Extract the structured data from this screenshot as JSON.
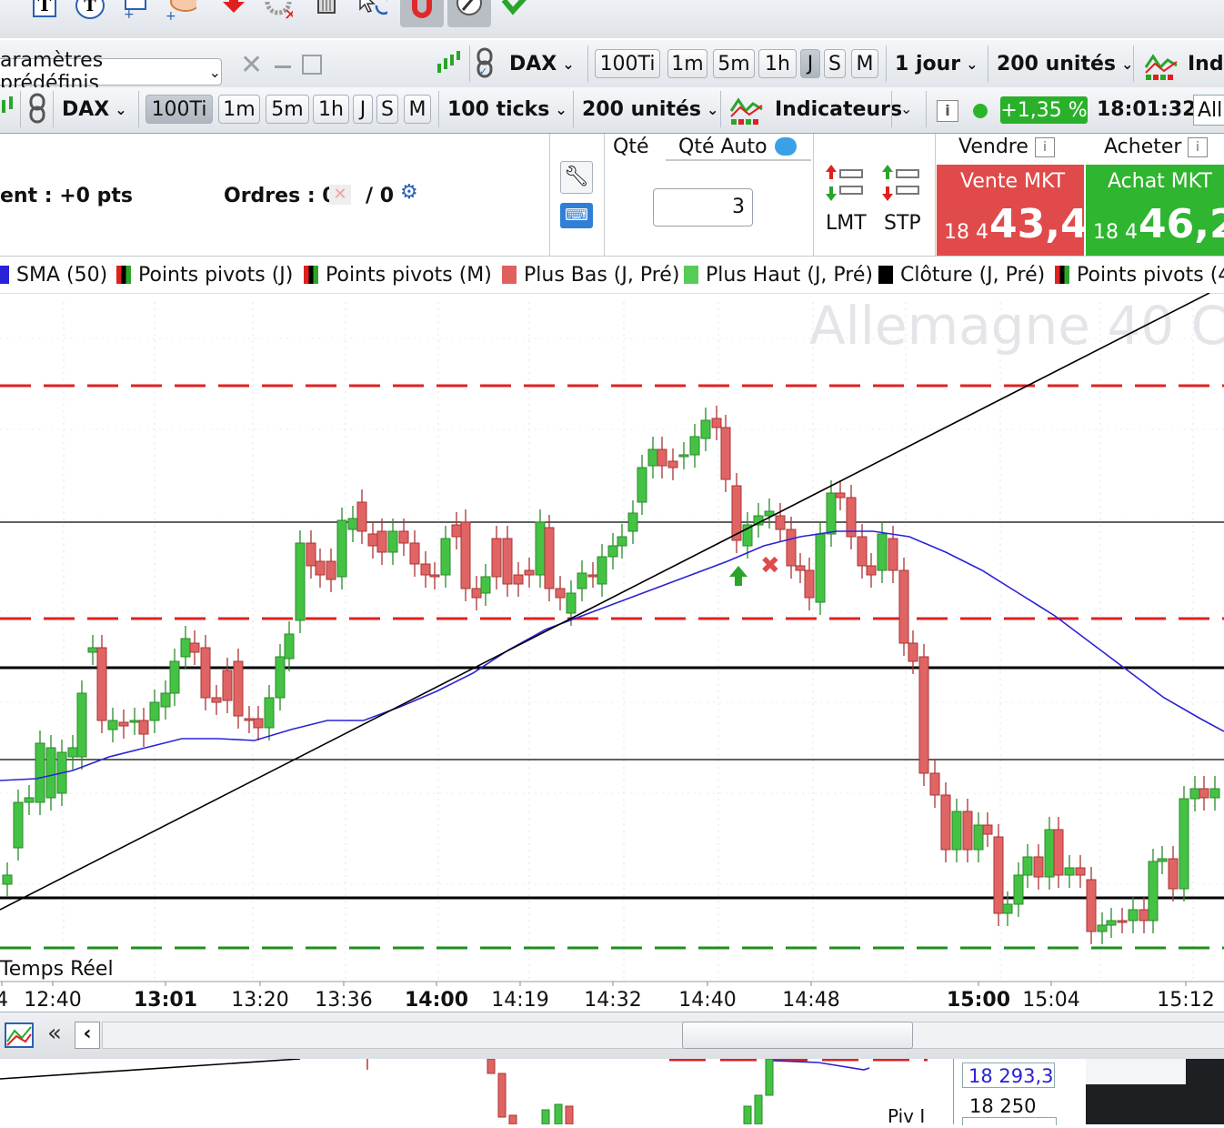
{
  "toolbar": {
    "icons": [
      "text-tool-icon",
      "text-bubble-icon",
      "rectangle-tool-icon",
      "ellipse-tool-icon",
      "arrow-down-icon",
      "delete-drawings-icon",
      "trash-icon",
      "cursor-undo-icon",
      "magnet-icon",
      "pencil-icon",
      "checkmark-icon"
    ]
  },
  "window_bar": {
    "presets": "aramètres prédéfinis",
    "instrument": "DAX",
    "timeframes": [
      "100Ti",
      "1m",
      "5m",
      "1h",
      "J",
      "S",
      "M"
    ],
    "period": "1 jour",
    "units": "200 unités",
    "indicators": "Indi"
  },
  "chart_bar": {
    "instrument": "DAX",
    "timeframes": [
      "100Ti",
      "1m",
      "5m",
      "1h",
      "J",
      "S",
      "M"
    ],
    "active_timeframe": "100Ti",
    "period": "100 ticks",
    "units": "200 unités",
    "indicators": "Indicateurs",
    "change": "+1,35 %",
    "time": "18:01:32",
    "alert": "All"
  },
  "order_panel": {
    "result_label": "ent : +0 pts",
    "orders_label": "Ordres : 0",
    "orders_pending": "/ 0",
    "qty_label": "Qté",
    "qty_auto_label": "Qté Auto",
    "qty_value": "3",
    "lmt_label": "LMT",
    "stp_label": "STP",
    "sell_header": "Vendre",
    "buy_header": "Acheter",
    "sell_label": "Vente MKT",
    "sell_price_small": "18 4",
    "sell_price_big": "43,4",
    "buy_label": "Achat MKT",
    "buy_price_small": "18 4",
    "buy_price_big": "46,2"
  },
  "legend": [
    {
      "label": "SMA (50)",
      "color": "#2a22d6"
    },
    {
      "label": "Points pivots (J)",
      "color": "#000000"
    },
    {
      "label": "Points pivots (M)",
      "color": "#000000"
    },
    {
      "label": "Plus Bas (J, Pré)",
      "color": "#e06060"
    },
    {
      "label": "Plus Haut (J, Pré)",
      "color": "#55cc55"
    },
    {
      "label": "Clôture (J, Pré)",
      "color": "#000000"
    },
    {
      "label": "Points pivots (4",
      "color": "#000000"
    }
  ],
  "chart": {
    "watermark": "Allemagne 40 C",
    "status": "Temps Réel",
    "up_color": "#44c244",
    "down_color": "#e06464",
    "sma_color": "#2a22d6",
    "time_labels": [
      {
        "t": "4",
        "bold": false
      },
      {
        "t": "12:40",
        "bold": false
      },
      {
        "t": "13:01",
        "bold": true
      },
      {
        "t": "13:20",
        "bold": false
      },
      {
        "t": "13:36",
        "bold": false
      },
      {
        "t": "14:00",
        "bold": true
      },
      {
        "t": "14:19",
        "bold": false
      },
      {
        "t": "14:32",
        "bold": false
      },
      {
        "t": "14:40",
        "bold": false
      },
      {
        "t": "14:48",
        "bold": false
      },
      {
        "t": "15:00",
        "bold": true
      },
      {
        "t": "15:04",
        "bold": false
      },
      {
        "t": "15:12",
        "bold": false
      }
    ]
  },
  "scroll_bar": {
    "rewind": "«",
    "back": "‹"
  },
  "mini_pane": {
    "pivot_label": "Piv I",
    "price_1": "18 293,3",
    "price_2": "18 250"
  }
}
